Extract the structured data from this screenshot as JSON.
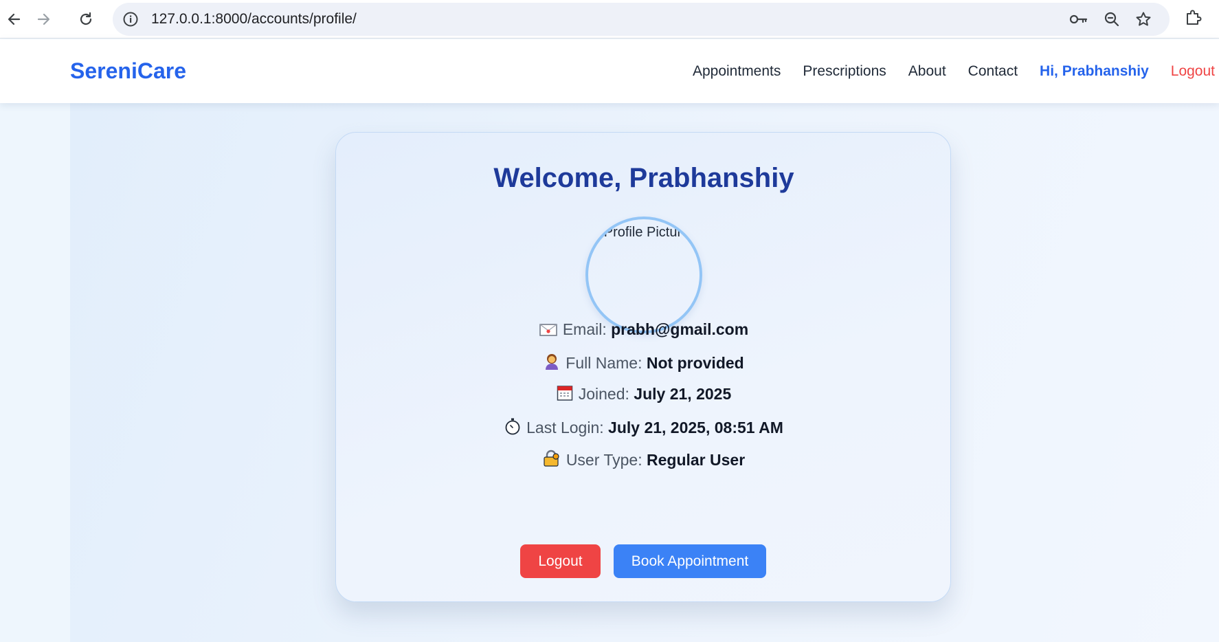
{
  "browser": {
    "url": "127.0.0.1:8000/accounts/profile/",
    "icons": [
      "back-arrow-icon",
      "forward-arrow-icon",
      "reload-icon",
      "site-info-icon",
      "key-icon",
      "zoom-icon",
      "star-icon",
      "extensions-icon"
    ]
  },
  "header": {
    "brand": "SereniCare",
    "nav": {
      "appointments": "Appointments",
      "prescriptions": "Prescriptions",
      "about": "About",
      "contact": "Contact",
      "greeting": "Hi, Prabhanshiy",
      "logout": "Logout"
    }
  },
  "profile": {
    "title": "Welcome, Prabhanshiy",
    "avatar_alt": "Profile Picture",
    "email_label": "Email:",
    "email_value": "prabh@gmail.com",
    "full_name_label": "Full Name:",
    "full_name_value": "Not provided",
    "joined_label": "Joined:",
    "joined_value": "July 21, 2025",
    "last_login_label": "Last Login:",
    "last_login_value": "July 21, 2025, 08:51 AM",
    "user_type_label": "User Type:",
    "user_type_value": "Regular User",
    "logout_button": "Logout",
    "book_button": "Book Appointment"
  },
  "colors": {
    "brand": "#2563eb",
    "title": "#1e3a9a",
    "logout": "#ef4444",
    "primary_button": "#3b82f6"
  }
}
